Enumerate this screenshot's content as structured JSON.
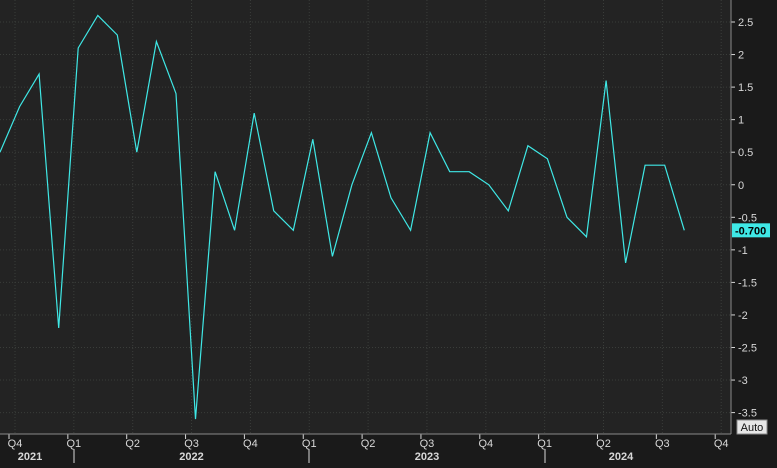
{
  "chart_data": {
    "type": "line",
    "title": "",
    "xlabel": "",
    "ylabel": "",
    "ylim": [
      -3.7,
      2.75
    ],
    "grid": true,
    "y_ticks": [
      2.5,
      2,
      1.5,
      1,
      0.5,
      0,
      -0.5,
      -1,
      -1.5,
      -2,
      -2.5,
      -3,
      -3.5
    ],
    "y_tick_labels": [
      "2.5",
      "2",
      "1.5",
      "1",
      "0.5",
      "0",
      "-0.5",
      "-1",
      "-1.5",
      "-2",
      "-2.5",
      "-3",
      "-3.5"
    ],
    "quarter_ticks": [
      "Q4",
      "Q1",
      "Q2",
      "Q3",
      "Q4",
      "Q1",
      "Q2",
      "Q3",
      "Q4",
      "Q1",
      "Q2",
      "Q3",
      "Q4"
    ],
    "year_labels": [
      "2021",
      "2022",
      "2023",
      "2024"
    ],
    "last_value_label": "-0.700",
    "scale_mode_label": "Auto",
    "series": [
      {
        "values": [
          0.5,
          1.2,
          1.7,
          -2.2,
          2.1,
          2.6,
          2.3,
          0.5,
          2.2,
          1.4,
          -3.6,
          0.2,
          -0.7,
          1.1,
          -0.4,
          -0.7,
          0.7,
          -1.1,
          0.0,
          0.8,
          -0.2,
          -0.7,
          0.8,
          0.2,
          0.2,
          0.0,
          -0.4,
          0.6,
          0.4,
          -0.5,
          -0.8,
          1.6,
          -1.2,
          0.3,
          0.3,
          -0.7
        ]
      }
    ],
    "colors": {
      "background": "#1a1a1a",
      "plot_background": "#232323",
      "grid": "#3a3d3a",
      "line": "#3fe8e6",
      "text": "#d8d8d8",
      "last_value_badge": "#3fe8e6",
      "last_value_text": "#000000"
    }
  }
}
